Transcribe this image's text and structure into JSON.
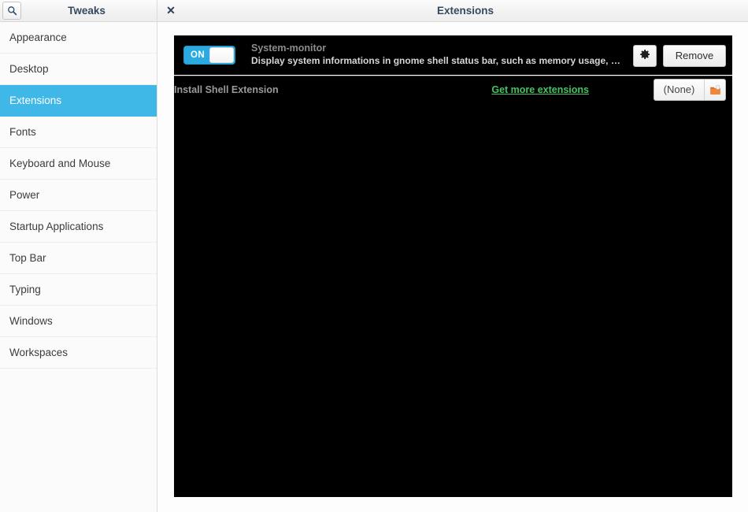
{
  "window": {
    "title_left": "Tweaks",
    "title_right": "Extensions",
    "search_icon": "search-icon",
    "close_icon": "close-icon"
  },
  "sidebar": {
    "items": [
      {
        "label": "Appearance",
        "selected": false
      },
      {
        "label": "Desktop",
        "selected": false
      },
      {
        "label": "Extensions",
        "selected": true
      },
      {
        "label": "Fonts",
        "selected": false
      },
      {
        "label": "Keyboard and Mouse",
        "selected": false
      },
      {
        "label": "Power",
        "selected": false
      },
      {
        "label": "Startup Applications",
        "selected": false
      },
      {
        "label": "Top Bar",
        "selected": false
      },
      {
        "label": "Typing",
        "selected": false
      },
      {
        "label": "Windows",
        "selected": false
      },
      {
        "label": "Workspaces",
        "selected": false
      }
    ]
  },
  "main": {
    "extensions": [
      {
        "name": "System-monitor",
        "description": "Display system informations in gnome shell status bar, such as memory usage, cpu us...",
        "toggle_state": "ON",
        "settings_icon": "gear-icon",
        "remove_label": "Remove"
      }
    ],
    "install": {
      "label": "Install Shell Extension",
      "more_link": "Get more extensions",
      "file_value": "(None)",
      "file_icon": "folder-icon"
    }
  },
  "colors": {
    "accent": "#3fb8e8",
    "toggle_on": "#2aaae0",
    "link": "#44c463",
    "panel_bg": "#000000"
  }
}
